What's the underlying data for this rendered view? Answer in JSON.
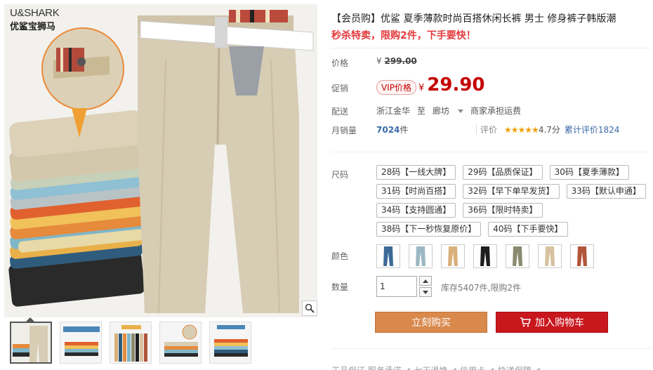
{
  "brand": {
    "name_en": "U&SHARK",
    "name_cn": "优鲨宝狮马"
  },
  "product": {
    "title": "【会员购】优鲨 夏季薄款时尚百搭休闲长裤 男士 修身裤子韩版潮",
    "promo": "秒杀特卖，限购2件，下手要快！"
  },
  "labels": {
    "price": "价格",
    "promo_price": "促销",
    "shipping": "配送",
    "monthly_sales": "月销量",
    "rating": "评价",
    "size": "尺码",
    "color": "颜色",
    "quantity": "数量"
  },
  "price": {
    "currency": "¥",
    "original": "299.00",
    "vip_label": "VIP价格",
    "current": "29.90"
  },
  "shipping": {
    "from": "浙江金华",
    "to_word": "至",
    "to": "廊坊",
    "fee": "商家承担运费"
  },
  "sales": {
    "count": "7024",
    "unit": "件"
  },
  "rating": {
    "stars": "★★★★★",
    "score": "4.7分",
    "total": "累计评价1824"
  },
  "sizes": [
    "28码【一线大牌】",
    "29码【品质保证】",
    "30码【夏季薄款】",
    "31码【时尚百搭】",
    "32码【早下单早发货】",
    "33码【默认申通】",
    "34码【支持圆通】",
    "36码【限时特卖】",
    "38码【下一秒恢复原价】",
    "40码【下手要快】"
  ],
  "colors": [
    {
      "icon": "jeans-blue-icon",
      "hex": "#3d6a96"
    },
    {
      "icon": "jeans-lightblue-icon",
      "hex": "#9bb7c4"
    },
    {
      "icon": "pants-khaki-icon",
      "hex": "#d8b07a"
    },
    {
      "icon": "pants-black-icon",
      "hex": "#1e1e1e"
    },
    {
      "icon": "pants-olive-icon",
      "hex": "#8a8a6e"
    },
    {
      "icon": "pants-beige-icon",
      "hex": "#d7c2a0"
    },
    {
      "icon": "pants-rust-icon",
      "hex": "#b0553a"
    }
  ],
  "quantity": {
    "value": "1",
    "stock_text": "库存5407件,限购2件"
  },
  "buttons": {
    "buy_now": "立刻购买",
    "add_cart": "加入购物车"
  },
  "bottom_row": "正品保证 服务承诺 ✔ 七天退换 ✔ 信用卡 ✔ 快递保障 ✔",
  "theme": {
    "accent_red": "#c40000",
    "buy_orange": "#d9894c",
    "cart_red": "#c9171e",
    "link_blue": "#3a6aa8"
  }
}
